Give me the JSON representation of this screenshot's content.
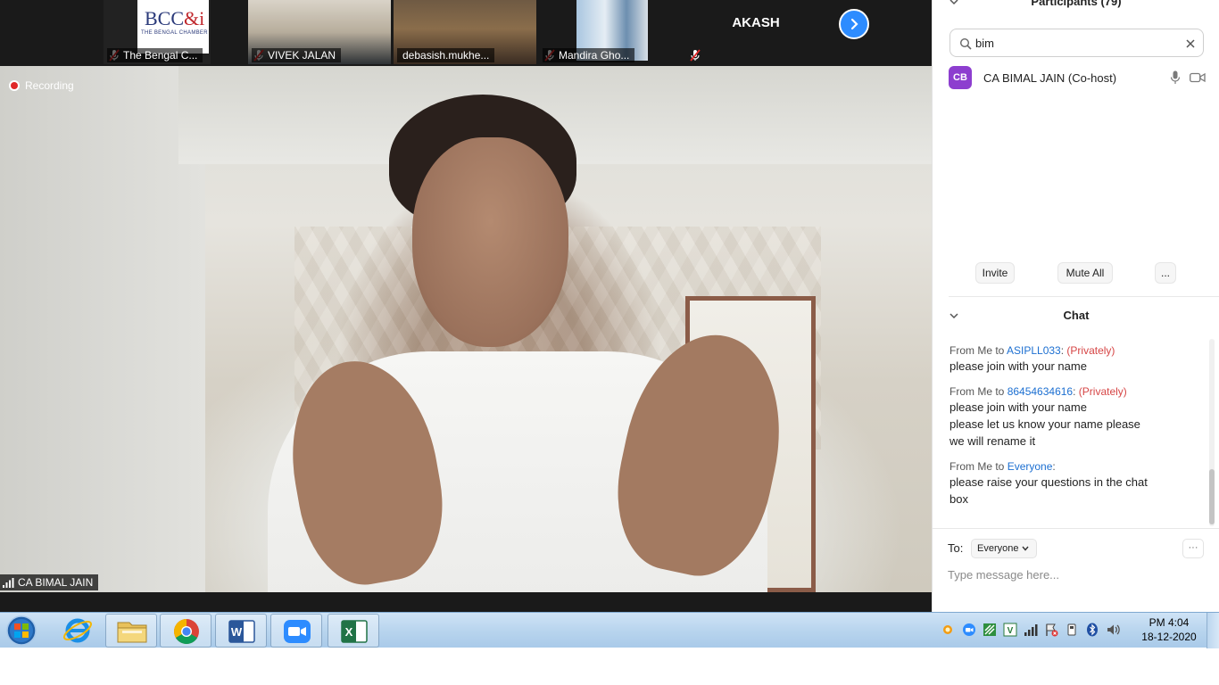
{
  "thumbnails": [
    {
      "name": "The Bengal C..."
    },
    {
      "name": "VIVEK JALAN"
    },
    {
      "name": "debasish.mukhe..."
    },
    {
      "name": "Mandira Gho..."
    },
    {
      "name": "AKASH"
    }
  ],
  "bcc_logo": {
    "text": "BCC",
    "amp": "&i",
    "sub": "THE BENGAL CHAMBER"
  },
  "recording": {
    "label": "Recording"
  },
  "active_speaker": {
    "name": "CA BIMAL JAIN"
  },
  "participants": {
    "title": "Participants (79)",
    "search_value": "bim",
    "list": [
      {
        "initials": "CB",
        "name": "CA BIMAL JAIN (Co-host)",
        "avatar_color": "#8d3ecf"
      }
    ],
    "buttons": {
      "invite": "Invite",
      "mute_all": "Mute All",
      "more": "..."
    }
  },
  "chat": {
    "title": "Chat",
    "messages": [
      {
        "from": "From Me to ",
        "to": "ASIPLL033",
        "sep": ":",
        "private": "(Privately)",
        "lines": [
          "please join with your name"
        ]
      },
      {
        "from": "From Me to ",
        "to": "86454634616",
        "sep": ":",
        "private": "(Privately)",
        "lines": [
          "please join with your name",
          "please let us know your name please",
          "we will rename it"
        ]
      },
      {
        "from": "From Me to ",
        "to": "Everyone",
        "sep": ":",
        "private": "",
        "lines": [
          "please raise your questions in the chat",
          "box"
        ]
      }
    ],
    "to_label": "To:",
    "recipient": "Everyone",
    "more": "···",
    "input_placeholder": "Type message here..."
  },
  "taskbar": {
    "apps": [
      "start-orb",
      "internet-explorer",
      "file-explorer",
      "chrome",
      "word",
      "zoom",
      "excel"
    ],
    "clock_time": "PM 4:04",
    "clock_date": "18-12-2020"
  },
  "colors": {
    "accent_blue": "#2d8cff",
    "avatar_purple": "#8d3ecf",
    "private_red": "#d64545",
    "link_blue": "#1c6fd1"
  }
}
